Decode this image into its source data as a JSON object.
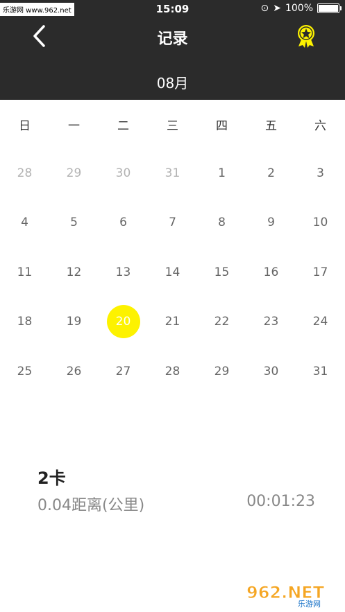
{
  "status": {
    "watermark": "乐游网 www.962.net",
    "time": "15:09",
    "battery": "100%"
  },
  "header": {
    "title": "记录",
    "month": "08月"
  },
  "calendar": {
    "weekdays": [
      "日",
      "一",
      "二",
      "三",
      "四",
      "五",
      "六"
    ],
    "weeks": [
      [
        "28",
        "29",
        "30",
        "31",
        "1",
        "2",
        "3"
      ],
      [
        "4",
        "5",
        "6",
        "7",
        "8",
        "9",
        "10"
      ],
      [
        "11",
        "12",
        "13",
        "14",
        "15",
        "16",
        "17"
      ],
      [
        "18",
        "19",
        "20",
        "21",
        "22",
        "23",
        "24"
      ],
      [
        "25",
        "26",
        "27",
        "28",
        "29",
        "30",
        "31"
      ]
    ],
    "selected": "20"
  },
  "summary": {
    "calories": "2卡",
    "distance": "0.04距离(公里)",
    "duration": "00:01:23"
  },
  "colors": {
    "header_bg": "#2b2b2b",
    "selected": "#fdf200"
  },
  "watermark_bottom": {
    "brand": "962.NET",
    "sub": "乐游网"
  }
}
